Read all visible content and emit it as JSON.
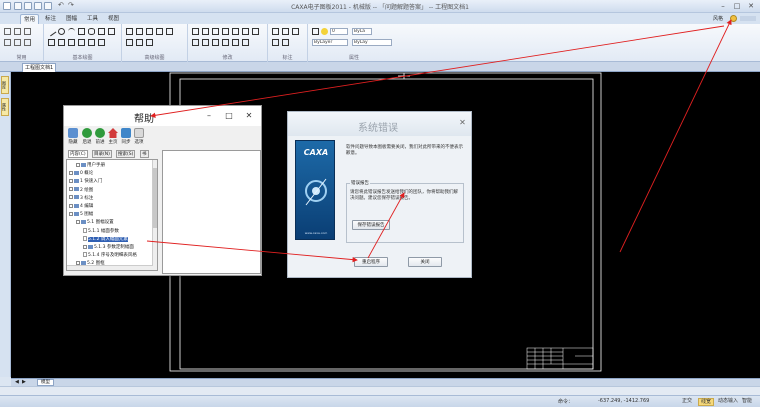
{
  "titlebar": {
    "title": "CAXA电子图板2011 - 机械版 -- 「问题解题答案」 -- 工程图文档1",
    "minimize": "–",
    "maximize": "□",
    "close": "✕"
  },
  "ribbon": {
    "tabs": [
      "常用",
      "标注",
      "图幅",
      "工具",
      "视图"
    ],
    "active_tab": "常用",
    "groups": [
      "常用",
      "基本绘图",
      "高级绘图",
      "修改",
      "标注",
      "属性"
    ],
    "help_label": "风格",
    "layer_value": "0",
    "color_value": "ByLa",
    "linetype_value": "ByLayer",
    "linewidth_value": "ByLay"
  },
  "document": {
    "tab_label": "工程图文档1"
  },
  "left_strip": {
    "buttons": [
      "图库",
      "属性"
    ]
  },
  "help_window": {
    "title": "帮助",
    "minimize": "–",
    "maximize": "□",
    "close": "✕",
    "toolbar": [
      "隐藏",
      "后退",
      "前进",
      "主页",
      "同步",
      "选项"
    ],
    "pane_tabs": [
      "内容(C)",
      "目录(N)",
      "搜索(S)",
      "书"
    ],
    "tree": [
      {
        "label": "用户手册",
        "indent": 1,
        "kind": "book"
      },
      {
        "label": "0 概论",
        "indent": 0,
        "kind": "book"
      },
      {
        "label": "1 快速入门",
        "indent": 0,
        "kind": "book"
      },
      {
        "label": "2 绘图",
        "indent": 0,
        "kind": "book"
      },
      {
        "label": "3 标注",
        "indent": 0,
        "kind": "book"
      },
      {
        "label": "4 编辑",
        "indent": 0,
        "kind": "book"
      },
      {
        "label": "5 图幅",
        "indent": 0,
        "kind": "book"
      },
      {
        "label": "5.1 图幅设置",
        "indent": 1,
        "kind": "book"
      },
      {
        "label": "5.1.1 幅面参数",
        "indent": 2,
        "kind": "page"
      },
      {
        "label": "5.1.2 调入幅面元素",
        "indent": 2,
        "kind": "page",
        "selected": true
      },
      {
        "label": "5.1.3 参数定制幅面",
        "indent": 2,
        "kind": "book"
      },
      {
        "label": "5.1.4 序号及明细表风格",
        "indent": 2,
        "kind": "page"
      },
      {
        "label": "5.2 图框",
        "indent": 1,
        "kind": "book"
      }
    ]
  },
  "error_dialog": {
    "title": "系统错误",
    "close": "✕",
    "logo_text": "CAXA",
    "logo_url": "www.caxa.com",
    "message": "软件问题导致本图板需要关闭，我们对此所带来的不便表示歉意。",
    "report_legend": "错误报告",
    "report_text": "请您将此错误报告发送给我们的团队，你将帮助我们解决问题。建议您保存错误报告。",
    "save_report_button": "保存错误报告",
    "restart_button": "重启程序",
    "close_button": "关闭"
  },
  "bottom": {
    "sheet_tab": "模型",
    "status_left": "",
    "status_prompt": "命令：",
    "coords": "-637.249, -1412.769",
    "buttons": [
      "正交",
      "线宽",
      "动态输入",
      "智能"
    ]
  },
  "colors": {
    "annotation_arrow": "#e02020",
    "canvas": "#000000",
    "drawing_frame": "#ffffff"
  }
}
